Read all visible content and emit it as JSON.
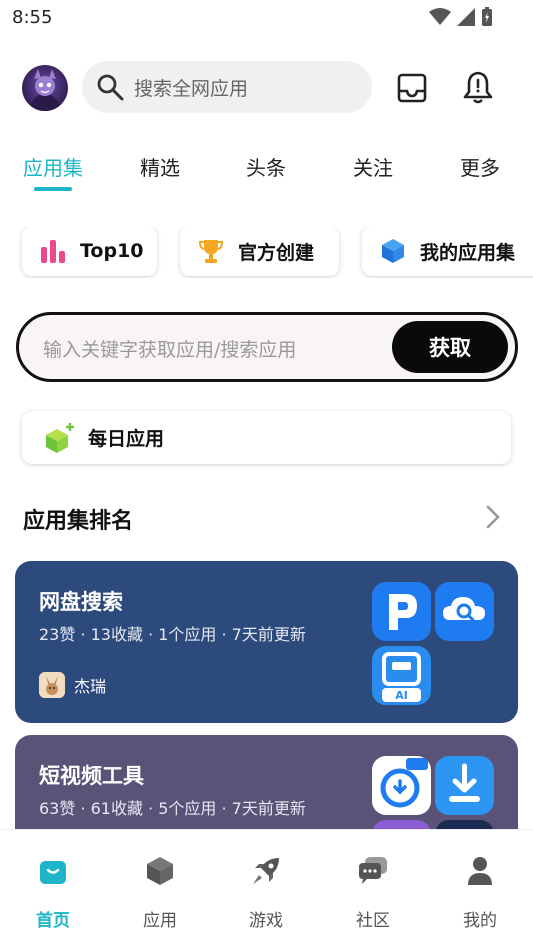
{
  "status_bar": {
    "time": "8:55"
  },
  "search": {
    "placeholder": "搜索全网应用"
  },
  "tabs": [
    {
      "label": "应用集",
      "active": true
    },
    {
      "label": "精选"
    },
    {
      "label": "头条"
    },
    {
      "label": "关注"
    },
    {
      "label": "更多"
    }
  ],
  "chips": [
    {
      "label": "Top10",
      "icon": "bar-chart-icon"
    },
    {
      "label": "官方创建",
      "icon": "trophy-icon"
    },
    {
      "label": "我的应用集",
      "icon": "cube-icon"
    }
  ],
  "fetch": {
    "placeholder": "输入关键字获取应用/搜索应用",
    "button": "获取"
  },
  "daily": {
    "label": "每日应用",
    "icon": "cube-plus-icon"
  },
  "ranking": {
    "title": "应用集排名",
    "cards": [
      {
        "title": "网盘搜索",
        "meta": "23赞 · 13收藏 · 1个应用 · 7天前更新",
        "author": "杰瑞",
        "color": "#2d4a7d"
      },
      {
        "title": "短视频工具",
        "meta": "63赞 · 61收藏 · 5个应用 · 7天前更新",
        "color": "#5a5377"
      }
    ]
  },
  "nav": [
    {
      "label": "首页",
      "icon": "home-bag-icon",
      "active": true
    },
    {
      "label": "应用",
      "icon": "cube-icon"
    },
    {
      "label": "游戏",
      "icon": "rocket-icon"
    },
    {
      "label": "社区",
      "icon": "chat-icon"
    },
    {
      "label": "我的",
      "icon": "person-icon"
    }
  ],
  "colors": {
    "accent": "#1fb5c8"
  }
}
